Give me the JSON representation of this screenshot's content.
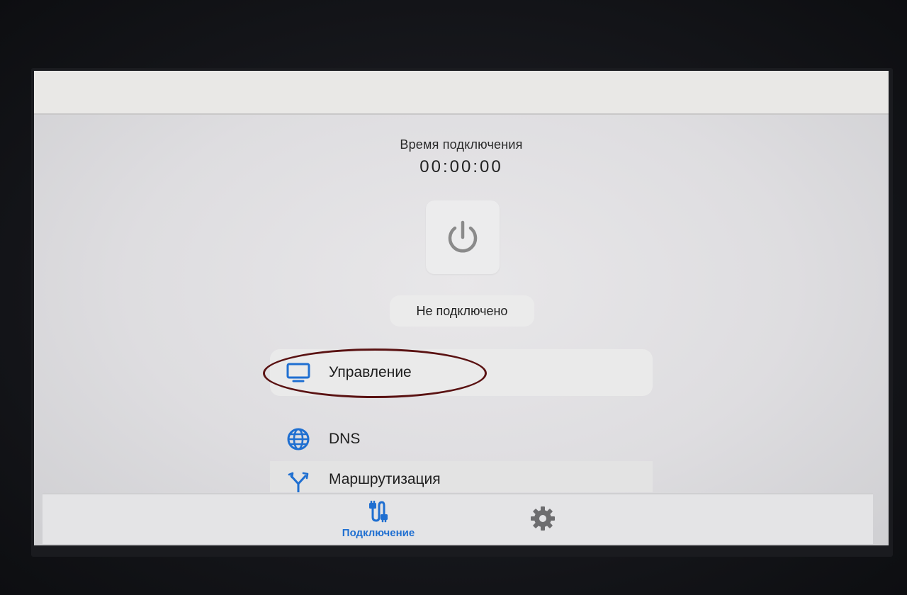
{
  "connection_time": {
    "label": "Время подключения",
    "value": "00:00:00"
  },
  "power_button": {
    "icon": "power-icon",
    "color": "#8a8a8a"
  },
  "status": {
    "text": "Не подключено"
  },
  "menu": {
    "items": [
      {
        "label": "Управление",
        "icon": "tv-monitor-icon"
      },
      {
        "label": "DNS",
        "icon": "globe-icon"
      },
      {
        "label": "Маршрутизация",
        "icon": "split-arrows-icon"
      }
    ]
  },
  "bottom_nav": {
    "connection_label": "Подключение",
    "connection_icon": "cable-plug-icon",
    "settings_icon": "gear-icon",
    "accent_color": "#1f6fd1",
    "inactive_color": "#6d6d6f"
  },
  "colors": {
    "accent": "#1f6fd1",
    "highlight_ellipse": "#5a1212"
  }
}
